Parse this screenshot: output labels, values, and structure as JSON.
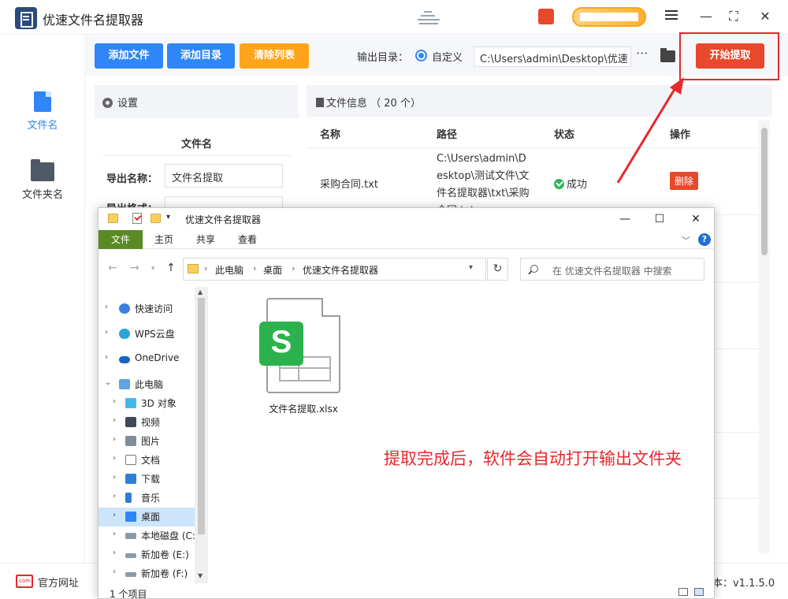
{
  "app": {
    "title": "优速文件名提取器"
  },
  "sidebar": {
    "items": [
      {
        "label": "文件名",
        "icon": "file-icon",
        "active": true
      },
      {
        "label": "文件夹名",
        "icon": "folder-icon",
        "active": false
      }
    ]
  },
  "toolbar": {
    "add_file": "添加文件",
    "add_dir": "添加目录",
    "clear_list": "清除列表",
    "output_dir_label": "输出目录：",
    "radio_label": "自定义",
    "output_path": "C:\\Users\\admin\\Desktop\\优速",
    "more": "···",
    "start": "开始提取"
  },
  "settings": {
    "header": "设置",
    "section": "文件名",
    "export_name_label": "导出名称：",
    "export_name_value": "文件名提取",
    "export_format_label": "导出格式："
  },
  "file_info": {
    "header": "文件信息 （ 20 个）",
    "columns": [
      "名称",
      "路径",
      "状态",
      "操作"
    ],
    "rows": [
      {
        "name": "采购合同.txt",
        "path": "C:\\Users\\admin\\Desktop\\测试文件\\文件名提取器\\txt\\采购合同.txt",
        "status": "成功",
        "action": "删除"
      }
    ]
  },
  "statusbar": {
    "site_link": "官方网址",
    "version": "本：v1.1.5.0"
  },
  "explorer": {
    "title": "优速文件名提取器",
    "ribbon_tabs": [
      "文件",
      "主页",
      "共享",
      "查看"
    ],
    "breadcrumbs": [
      "此电脑",
      "桌面",
      "优速文件名提取器"
    ],
    "search_placeholder": "在 优速文件名提取器 中搜索",
    "nav_items": [
      {
        "label": "快速访问",
        "icon": "star-icon"
      },
      {
        "label": "WPS云盘",
        "icon": "cloud-icon"
      },
      {
        "label": "OneDrive",
        "icon": "onedrive-icon"
      },
      {
        "label": "此电脑",
        "icon": "computer-icon"
      },
      {
        "label": "3D 对象",
        "icon": "cube-icon"
      },
      {
        "label": "视频",
        "icon": "video-icon"
      },
      {
        "label": "图片",
        "icon": "picture-icon"
      },
      {
        "label": "文档",
        "icon": "document-icon"
      },
      {
        "label": "下载",
        "icon": "download-icon"
      },
      {
        "label": "音乐",
        "icon": "music-icon"
      },
      {
        "label": "桌面",
        "icon": "desktop-icon"
      },
      {
        "label": "本地磁盘 (C:",
        "icon": "disk-icon"
      },
      {
        "label": "新加卷 (E:)",
        "icon": "drive-icon"
      },
      {
        "label": "新加卷 (F:)",
        "icon": "drive-icon"
      }
    ],
    "selected_nav": "桌面",
    "file_name": "文件名提取.xlsx",
    "annotation": "提取完成后，软件会自动打开输出文件夹",
    "item_count": "1 个项目"
  },
  "colors": {
    "primary": "#2f86f6",
    "warning": "#ffa41b",
    "danger": "#e8482b",
    "success": "#2cb55b",
    "annotation_red": "#e8282b",
    "wps_green": "#2bb24c",
    "ribbon_file_green": "#5a8a23"
  }
}
